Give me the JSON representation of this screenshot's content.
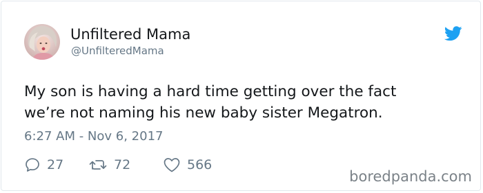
{
  "tweet": {
    "author": {
      "display_name": "Unfiltered Mama",
      "handle": "@UnfilteredMama",
      "avatar_icon": "profile-photo"
    },
    "text_lines": [
      "My son is having a hard time getting over the fact",
      "we’re not naming his new baby sister Megatron."
    ],
    "timestamp": "6:27 AM - Nov 6, 2017",
    "stats": {
      "replies": "27",
      "retweets": "72",
      "likes": "566"
    },
    "brand_icon": "twitter-bird-icon"
  },
  "watermark": "boredpanda.com",
  "colors": {
    "text_primary": "#14171a",
    "text_secondary": "#657786",
    "twitter_blue": "#1da1f2",
    "border": "#e1e8ed"
  }
}
